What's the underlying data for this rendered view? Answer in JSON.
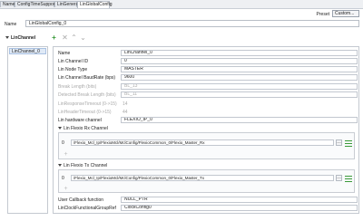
{
  "tabs": [
    "Name",
    "ConfigTimeSupport",
    "LinGeneral",
    "LinGlobalConfig"
  ],
  "preset": {
    "label": "Preset",
    "button": "Custom..."
  },
  "name_row": {
    "label": "Name",
    "value": "LinGlobalConfig_0"
  },
  "section": {
    "title": "LinChannel"
  },
  "list": {
    "items": [
      "LinChannel_0"
    ]
  },
  "fields": {
    "name": {
      "label": "Name",
      "value": "LinChannel_0"
    },
    "channel_id": {
      "label": "Lin Channel ID",
      "value": "0"
    },
    "node_type": {
      "label": "Lin Node Type",
      "value": "MASTER"
    },
    "baudrate": {
      "label": "Lin Channel BaudRate (bps)",
      "value": "9600"
    },
    "break_length": {
      "label": "Break Length (bits)",
      "value": "BL_13"
    },
    "detected_break": {
      "label": "Detected Break Length (bits)",
      "value": "BL_11"
    },
    "response_timeout": {
      "label": "LinResponseTimeout (0->15)",
      "value": "14"
    },
    "header_timeout": {
      "label": "LinHeaderTimeout (0->15)",
      "value": "44"
    },
    "hw_channel": {
      "label": "Lin hardware channel",
      "value": "FLEXIO_IP_0"
    },
    "callback": {
      "label": "User Callback function",
      "value": "NULL_PTR"
    },
    "clock_ref": {
      "label": "LinClockFunctionalGroupRef",
      "value": "ClockConfig0"
    }
  },
  "flexio_rx": {
    "header": "Lin Flexio Rx Channel",
    "index": "0",
    "path": "/Flexio_Mcl_Ip/FlexioMcl/MclConfig/FlexioCommon_0/Flexio_Master_Rx"
  },
  "flexio_tx": {
    "header": "Lin Flexio Tx Channel",
    "index": "0",
    "path": "/Flexio_Mcl_Ip/FlexioMcl/MclConfig/FlexioCommon_0/Flexio_Master_Tx"
  },
  "colors": {
    "accent_green": "#3a9a3a",
    "selection": "#dfe9f6"
  }
}
